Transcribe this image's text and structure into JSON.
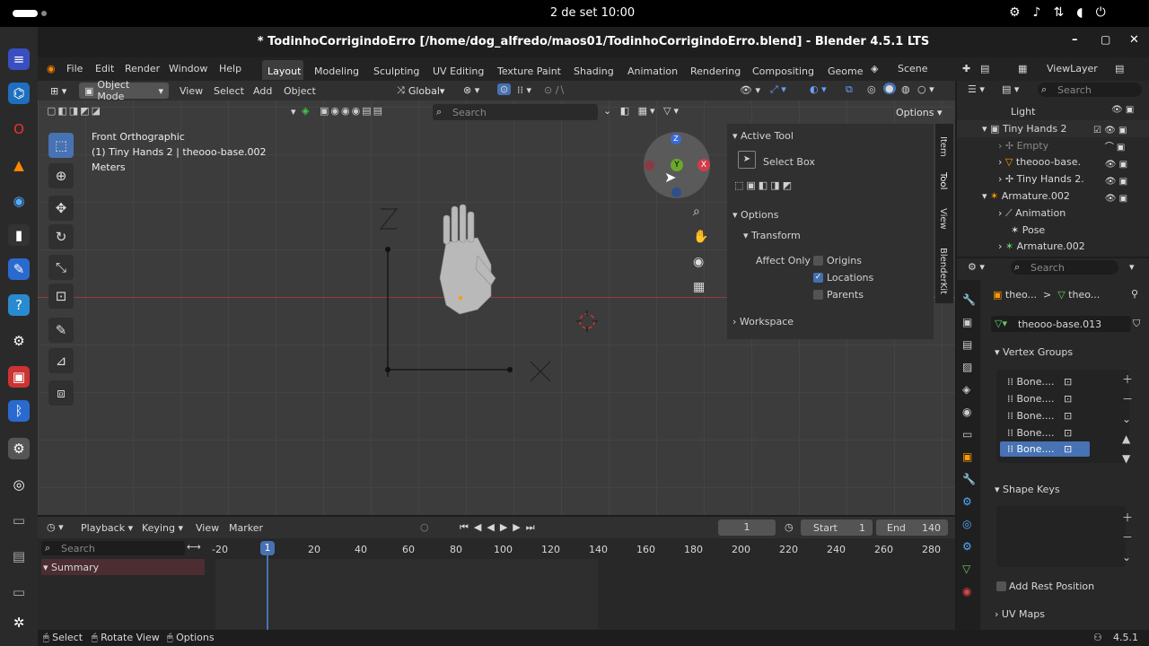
{
  "system": {
    "clock": "2 de set  10:00"
  },
  "window": {
    "title": "* TodinhoCorrigindoErro [/home/dog_alfredo/maos01/TodinhoCorrigindoErro.blend] - Blender 4.5.1 LTS"
  },
  "menu": {
    "items": [
      "File",
      "Edit",
      "Render",
      "Window",
      "Help"
    ]
  },
  "workspaces": [
    "Layout",
    "Modeling",
    "Sculpting",
    "UV Editing",
    "Texture Paint",
    "Shading",
    "Animation",
    "Rendering",
    "Compositing",
    "Geome"
  ],
  "scene": {
    "label": "Scene",
    "view_layer": "ViewLayer"
  },
  "viewport": {
    "mode": "Object Mode",
    "menus": [
      "View",
      "Select",
      "Add",
      "Object"
    ],
    "orientation": "Global",
    "search_placeholder": "Search",
    "options_label": "Options",
    "info": {
      "view": "Front Orthographic",
      "object": "(1) Tiny Hands 2 | theooo-base.002",
      "units": "Meters"
    },
    "gizmo": {
      "z": "Z",
      "y": "Y",
      "x": "X"
    }
  },
  "npanel": {
    "tabs": [
      "Item",
      "Tool",
      "View",
      "BlenderKit"
    ],
    "active_tool": {
      "header": "Active Tool",
      "tool": "Select Box"
    },
    "options": {
      "header": "Options",
      "transform": "Transform",
      "affect_only": "Affect Only",
      "origins": "Origins",
      "locations": "Locations",
      "parents": "Parents"
    },
    "workspace": "Workspace"
  },
  "outliner": {
    "search_placeholder": "Search",
    "items": [
      {
        "label": "Light",
        "indent": 4
      },
      {
        "label": "Tiny Hands 2",
        "indent": 2
      },
      {
        "label": "Empty",
        "indent": 3
      },
      {
        "label": "theooo-base.",
        "indent": 3
      },
      {
        "label": "Tiny Hands 2.",
        "indent": 3
      },
      {
        "label": "Armature.002",
        "indent": 2
      },
      {
        "label": "Animation",
        "indent": 3
      },
      {
        "label": "Pose",
        "indent": 3
      },
      {
        "label": "Armature.002",
        "indent": 3
      }
    ]
  },
  "properties": {
    "search_placeholder": "Search",
    "breadcrumb": [
      "theo...",
      "theo..."
    ],
    "mesh_name": "theooo-base.013",
    "vertex_groups": {
      "header": "Vertex Groups",
      "items": [
        "Bone....",
        "Bone....",
        "Bone....",
        "Bone....",
        "Bone...."
      ]
    },
    "shape_keys": "Shape Keys",
    "add_rest_position": "Add Rest Position",
    "uv_maps": "UV Maps"
  },
  "timeline": {
    "menus": [
      "Playback",
      "Keying",
      "View",
      "Marker"
    ],
    "current_frame": "1",
    "start_label": "Start",
    "start": "1",
    "end_label": "End",
    "end": "140",
    "search_placeholder": "Search",
    "summary": "Summary",
    "ticks": [
      "-20",
      "20",
      "40",
      "60",
      "80",
      "100",
      "120",
      "140",
      "160",
      "180",
      "200",
      "220",
      "240",
      "260",
      "280"
    ],
    "playhead": "1"
  },
  "status": {
    "items": [
      "Select",
      "Rotate View",
      "Options"
    ],
    "version": "4.5.1"
  }
}
